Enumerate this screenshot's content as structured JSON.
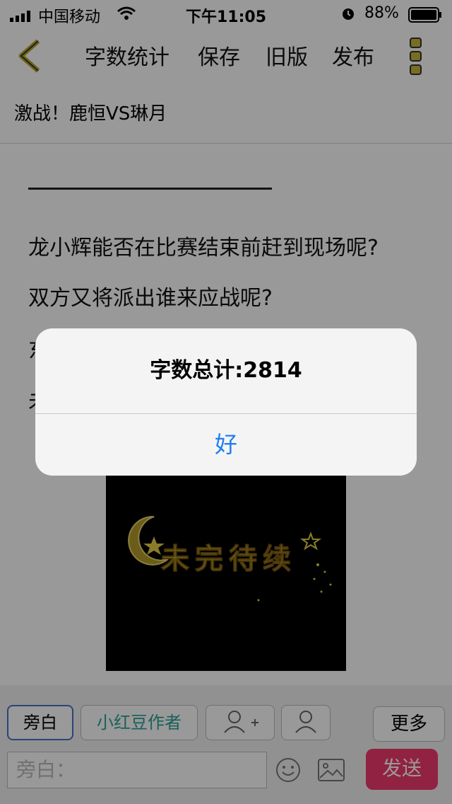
{
  "status_bar": {
    "carrier": "中国移动",
    "time": "下午11:05",
    "battery": "88%",
    "battery_fraction": 0.88
  },
  "nav": {
    "word_count_label": "字数统计",
    "save_label": "保存",
    "old_version_label": "旧版",
    "publish_label": "发布"
  },
  "story": {
    "title": "激战！鹿恒VS琳月",
    "paragraphs": [
      "龙小辉能否在比赛结束前赶到现场呢?",
      "双方又将派出谁来应战呢?",
      "东",
      "未"
    ],
    "image_text": "未完待续"
  },
  "bottom_bar": {
    "narration_chip": "旁白",
    "author_chip": "小红豆作者",
    "more_label": "更多",
    "input_placeholder": "旁白：",
    "send_label": "发送"
  },
  "alert": {
    "message": "字数总计:2814",
    "ok_label": "好"
  },
  "colors": {
    "accent_blue": "#1f7ef0",
    "send_button": "#f33a6f",
    "author_chip_text": "#2aa198",
    "back_arrow": "#b9a532"
  }
}
